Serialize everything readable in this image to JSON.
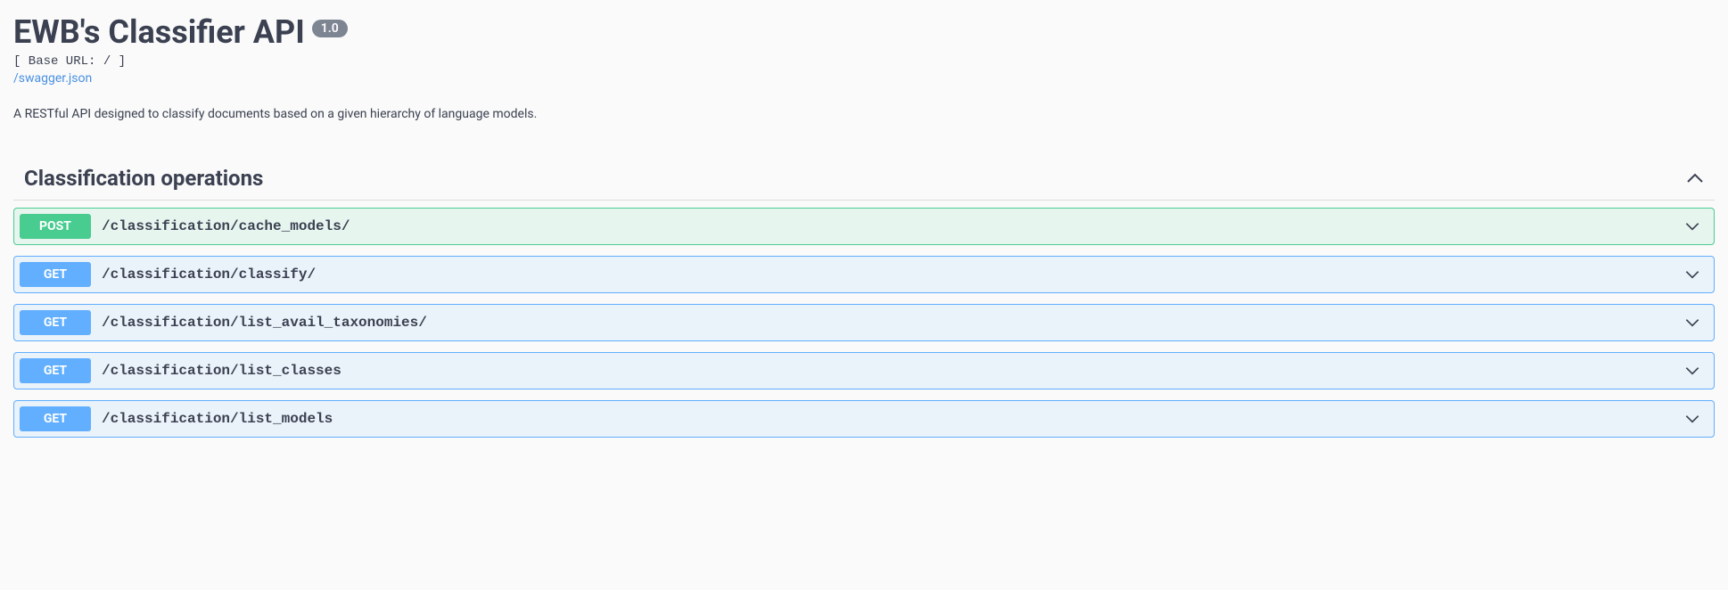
{
  "header": {
    "title": "EWB's Classifier API",
    "version": "1.0",
    "base_url_label": "[ Base URL: / ]",
    "spec_link": "/swagger.json",
    "description": "A RESTful API designed to classify documents based on a given hierarchy of language models."
  },
  "section": {
    "title": "Classification operations",
    "operations": [
      {
        "method": "POST",
        "path": "/classification/cache_models/"
      },
      {
        "method": "GET",
        "path": "/classification/classify/"
      },
      {
        "method": "GET",
        "path": "/classification/list_avail_taxonomies/"
      },
      {
        "method": "GET",
        "path": "/classification/list_classes"
      },
      {
        "method": "GET",
        "path": "/classification/list_models"
      }
    ]
  }
}
